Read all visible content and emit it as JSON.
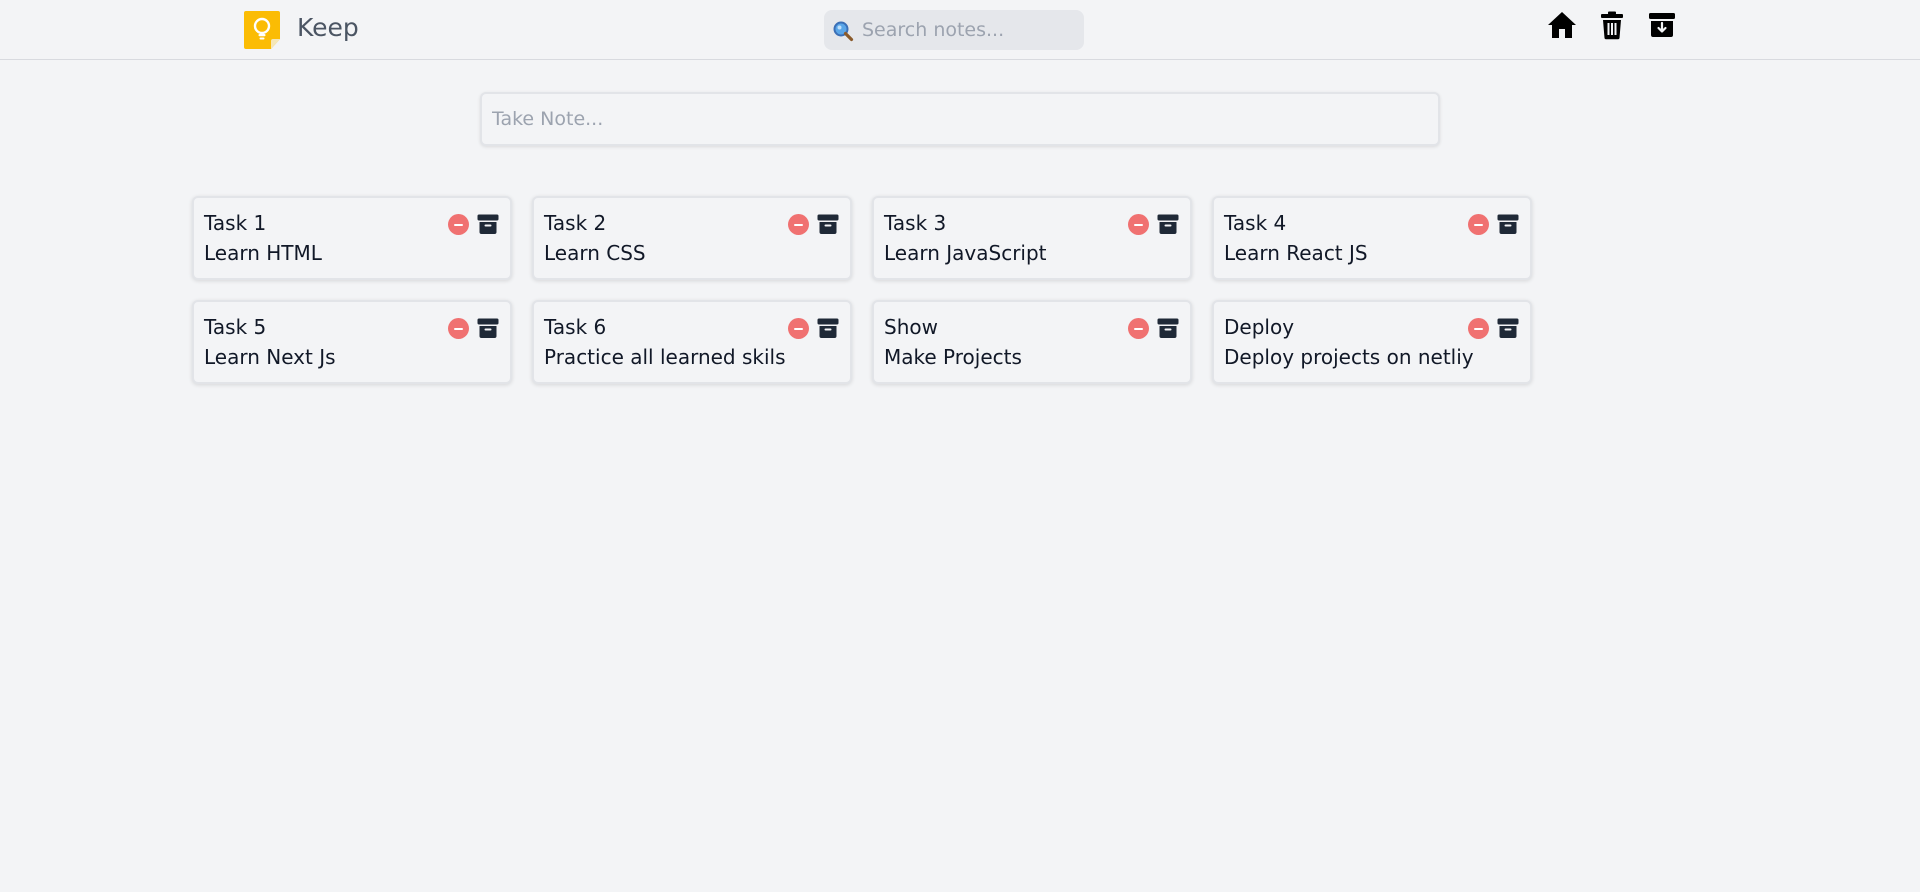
{
  "header": {
    "brand": "Keep",
    "logo_icon": "lightbulb-note-icon",
    "search": {
      "placeholder": "Search notes...",
      "value": "",
      "icon": "magnifier-icon"
    },
    "nav": [
      {
        "icon": "home-icon"
      },
      {
        "icon": "trash-icon"
      },
      {
        "icon": "archive-download-icon"
      }
    ]
  },
  "composer": {
    "placeholder": "Take Note...",
    "value": ""
  },
  "notes": [
    {
      "title": "Task 1",
      "body": "Learn HTML"
    },
    {
      "title": "Task 2",
      "body": "Learn CSS"
    },
    {
      "title": "Task 3",
      "body": "Learn JavaScript"
    },
    {
      "title": "Task 4",
      "body": "Learn React JS"
    },
    {
      "title": "Task 5",
      "body": "Learn Next Js"
    },
    {
      "title": "Task 6",
      "body": "Practice all learned skils"
    },
    {
      "title": "Show",
      "body": "Make Projects"
    },
    {
      "title": "Deploy",
      "body": "Deploy projects on netliy"
    }
  ],
  "note_actions": {
    "delete_icon": "remove-circle-icon",
    "archive_icon": "archive-box-icon"
  },
  "colors": {
    "background": "#f3f4f6",
    "delete": "#f07171",
    "archive": "#1f2937",
    "logo": "#fbbc04"
  }
}
